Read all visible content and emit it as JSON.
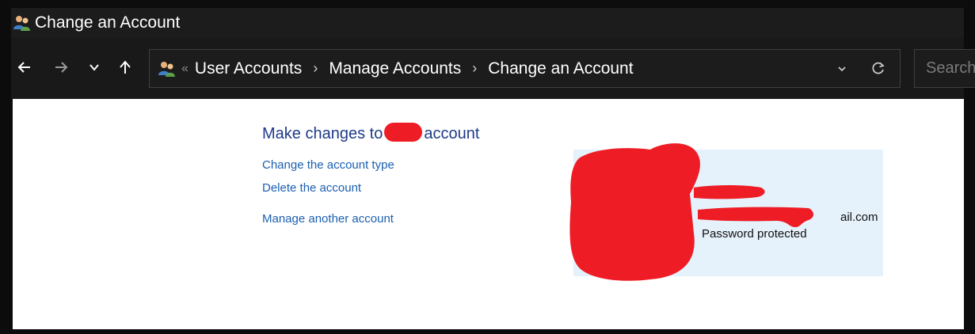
{
  "window": {
    "title": "Change an Account"
  },
  "navigation": {
    "breadcrumbs": [
      "User Accounts",
      "Manage Accounts",
      "Change an Account"
    ],
    "overflow_label": "«",
    "separator": "›",
    "search_placeholder": "Search"
  },
  "main": {
    "heading_prefix": "Make changes to",
    "heading_suffix": "account",
    "links": {
      "change_type": "Change the account type",
      "delete": "Delete the account",
      "manage_another": "Manage another account"
    },
    "card": {
      "email_visible": "ail.com",
      "status": "Password protected"
    }
  },
  "colors": {
    "redaction": "#ee1c25",
    "link": "#1b5fb0",
    "heading": "#1e3a8a",
    "card_bg": "#e5f1fb"
  }
}
